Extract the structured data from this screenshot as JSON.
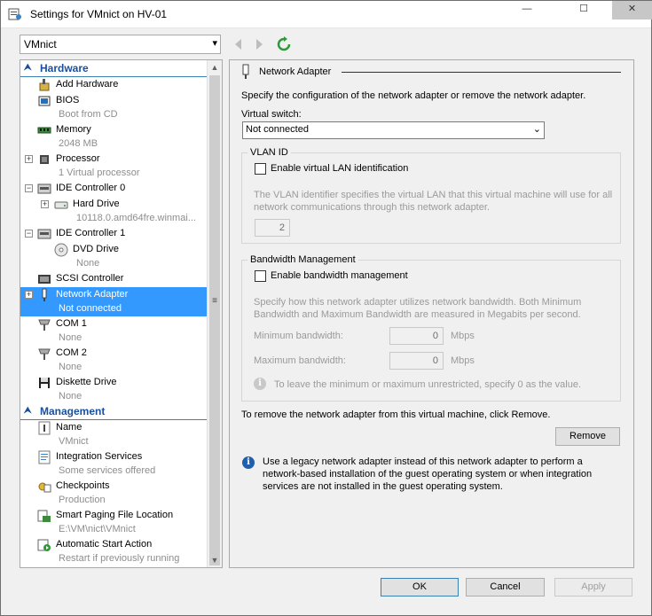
{
  "window": {
    "title": "Settings for VMnict on HV-01",
    "minimize": "—",
    "maximize": "☐",
    "close": "✕"
  },
  "toolbar": {
    "vm_select": "VMnict"
  },
  "sidebar": {
    "hardware_header": "Hardware",
    "management_header": "Management",
    "hardware": [
      {
        "label": "Add Hardware",
        "sub": ""
      },
      {
        "label": "BIOS",
        "sub": "Boot from CD"
      },
      {
        "label": "Memory",
        "sub": "2048 MB"
      },
      {
        "label": "Processor",
        "sub": "1 Virtual processor"
      },
      {
        "label": "IDE Controller 0",
        "sub": ""
      },
      {
        "label": "Hard Drive",
        "sub": "10118.0.amd64fre.winmai..."
      },
      {
        "label": "IDE Controller 1",
        "sub": ""
      },
      {
        "label": "DVD Drive",
        "sub": "None"
      },
      {
        "label": "SCSI Controller",
        "sub": ""
      },
      {
        "label": "Network Adapter",
        "sub": "Not connected"
      },
      {
        "label": "COM 1",
        "sub": "None"
      },
      {
        "label": "COM 2",
        "sub": "None"
      },
      {
        "label": "Diskette Drive",
        "sub": "None"
      }
    ],
    "management": [
      {
        "label": "Name",
        "sub": "VMnict"
      },
      {
        "label": "Integration Services",
        "sub": "Some services offered"
      },
      {
        "label": "Checkpoints",
        "sub": "Production"
      },
      {
        "label": "Smart Paging File Location",
        "sub": "E:\\VM\\nict\\VMnict"
      },
      {
        "label": "Automatic Start Action",
        "sub": "Restart if previously running"
      }
    ]
  },
  "panel": {
    "title": "Network Adapter",
    "intro": "Specify the configuration of the network adapter or remove the network adapter.",
    "virtual_switch_label": "Virtual switch:",
    "virtual_switch_value": "Not connected",
    "vlan": {
      "title": "VLAN ID",
      "checkbox": "Enable virtual LAN identification",
      "desc1": "The VLAN identifier specifies the virtual LAN that this virtual machine will use for all",
      "desc2": "network communications through this network adapter.",
      "value": "2"
    },
    "bandwidth": {
      "title": "Bandwidth Management",
      "checkbox": "Enable bandwidth management",
      "desc1": "Specify how this network adapter utilizes network bandwidth. Both Minimum",
      "desc2": "Bandwidth and Maximum Bandwidth are measured in Megabits per second.",
      "min_label": "Minimum bandwidth:",
      "min_value": "0",
      "max_label": "Maximum bandwidth:",
      "max_value": "0",
      "unit": "Mbps",
      "hint": "To leave the minimum or maximum unrestricted, specify 0 as the value."
    },
    "remove_text": "To remove the network adapter from this virtual machine, click Remove.",
    "remove_button": "Remove",
    "legacy_note1": "Use a legacy network adapter instead of this network adapter to perform a",
    "legacy_note2": "network-based installation of the guest operating system or when integration",
    "legacy_note3": "services are not installed in the guest operating system."
  },
  "buttons": {
    "ok": "OK",
    "cancel": "Cancel",
    "apply": "Apply"
  },
  "colors": {
    "selection": "#3399ff",
    "section_header": "#1a4f9c",
    "info": "#1f5fae"
  }
}
